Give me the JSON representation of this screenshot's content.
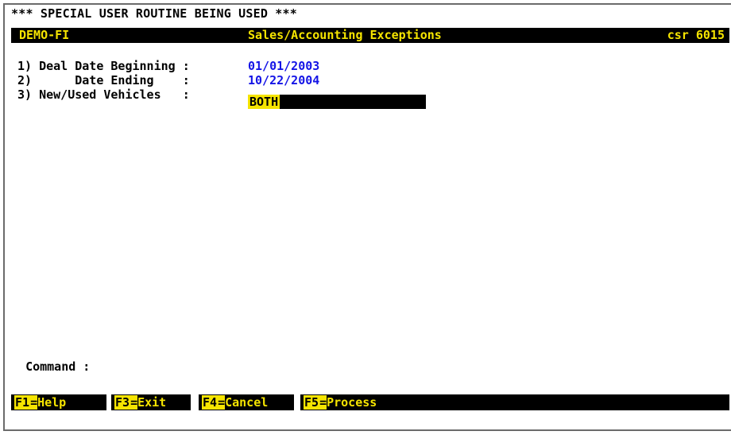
{
  "banner": "*** SPECIAL USER ROUTINE BEING USED ***",
  "titlebar": {
    "left": "DEMO-FI",
    "center": "Sales/Accounting Exceptions",
    "right": "csr 6015"
  },
  "fields": [
    {
      "label": "1) Deal Date Beginning : ",
      "value": "01/01/2003"
    },
    {
      "label": "2)      Date Ending    : ",
      "value": "10/22/2004"
    },
    {
      "label": "3) New/Used Vehicles   : ",
      "value": "BOTH"
    }
  ],
  "command": {
    "label": "Command :",
    "value": ""
  },
  "fkeys": [
    {
      "key": "F1",
      "sep": "=",
      "label": "Help"
    },
    {
      "key": "F3",
      "sep": "=",
      "label": "Exit"
    },
    {
      "key": "F4",
      "sep": "=",
      "label": "Cancel"
    },
    {
      "key": "F5",
      "sep": "=",
      "label": "Process"
    }
  ],
  "colors": {
    "highlight": "#f5e400",
    "value_text": "#1414e6",
    "bar": "#000000"
  }
}
